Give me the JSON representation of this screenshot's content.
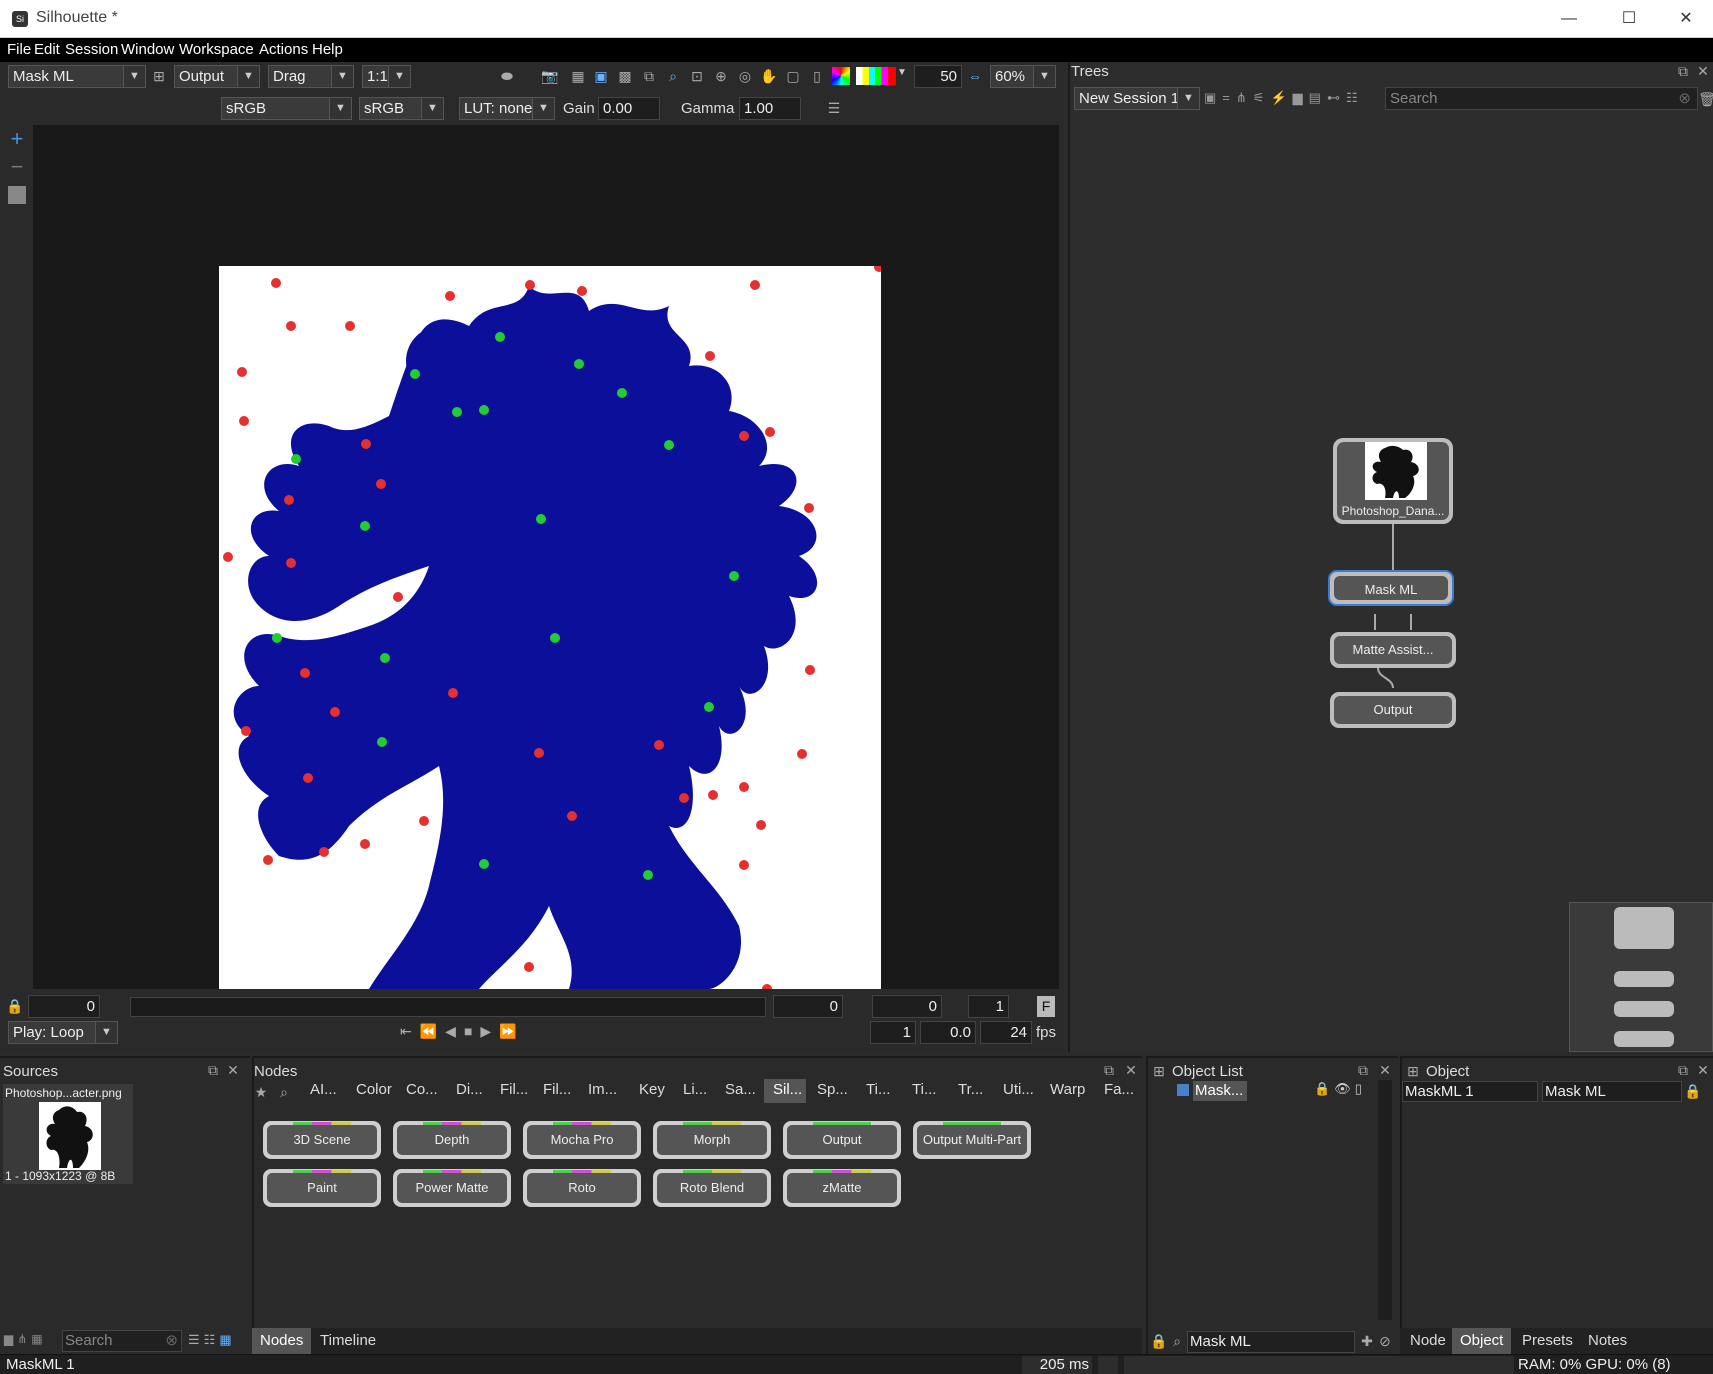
{
  "window": {
    "title": "Silhouette *",
    "minimize": "—",
    "maximize": "☐",
    "close": "✕"
  },
  "menu": [
    "File",
    "Edit",
    "Session",
    "Window",
    "Workspace",
    "Actions",
    "Help"
  ],
  "viewer_toolbar": {
    "node_select": "Mask ML",
    "view_select": "Output",
    "mode_select": "Drag",
    "ratio_select": "1:1",
    "brush_value": "50",
    "zoom_select": "60%",
    "colorspace_in": "sRGB",
    "colorspace_out": "sRGB",
    "lut_select": "LUT: none",
    "gain_label": "Gain",
    "gain_value": "0.00",
    "gamma_label": "Gamma",
    "gamma_value": "1.00"
  },
  "timeline": {
    "start_frame": "0",
    "current_a": "0",
    "current_b": "0",
    "end_frame": "1",
    "f_button": "F",
    "play_mode": "Play: Loop",
    "frame": "1",
    "time": "0.0",
    "fps_value": "24",
    "fps_label": "fps"
  },
  "trees": {
    "title": "Trees",
    "session_select": "New Session 1",
    "search_placeholder": "Search",
    "nodes": [
      "Photoshop_Dana...",
      "Mask ML",
      "Matte Assist...",
      "Output"
    ]
  },
  "sources": {
    "title": "Sources",
    "item_name": "Photoshop...acter.png",
    "item_info": "1 - 1093x1223 @ 8B",
    "search_placeholder": "Search"
  },
  "nodes_panel": {
    "title": "Nodes",
    "categories": [
      "AI...",
      "Color",
      "Co...",
      "Di...",
      "Fil...",
      "Fil...",
      "Im...",
      "Key",
      "Li...",
      "Sa...",
      "Sil...",
      "Sp...",
      "Ti...",
      "Ti...",
      "Tr...",
      "Uti...",
      "Warp",
      "Fa..."
    ],
    "active_category": "Sil...",
    "buttons": [
      "3D Scene",
      "Depth",
      "Mocha Pro",
      "Morph",
      "Output",
      "Output Multi-Part",
      "Paint",
      "Power Matte",
      "Roto",
      "Roto Blend",
      "zMatte"
    ],
    "tabs": [
      "Nodes",
      "Timeline"
    ]
  },
  "object_list": {
    "title": "Object List",
    "item": "Mask...",
    "filter_value": "Mask ML"
  },
  "object_panel": {
    "title": "Object",
    "name_value": "MaskML 1",
    "type_value": "Mask ML",
    "tabs": [
      "Node",
      "Object",
      "Presets",
      "Notes"
    ]
  },
  "statusbar": {
    "left": "MaskML 1",
    "timing": "205 ms",
    "resources": "RAM: 0% GPU: 0% (8)"
  },
  "colors": {
    "mask_blue": "#0b0f9a",
    "accent": "#3a7bd5"
  }
}
